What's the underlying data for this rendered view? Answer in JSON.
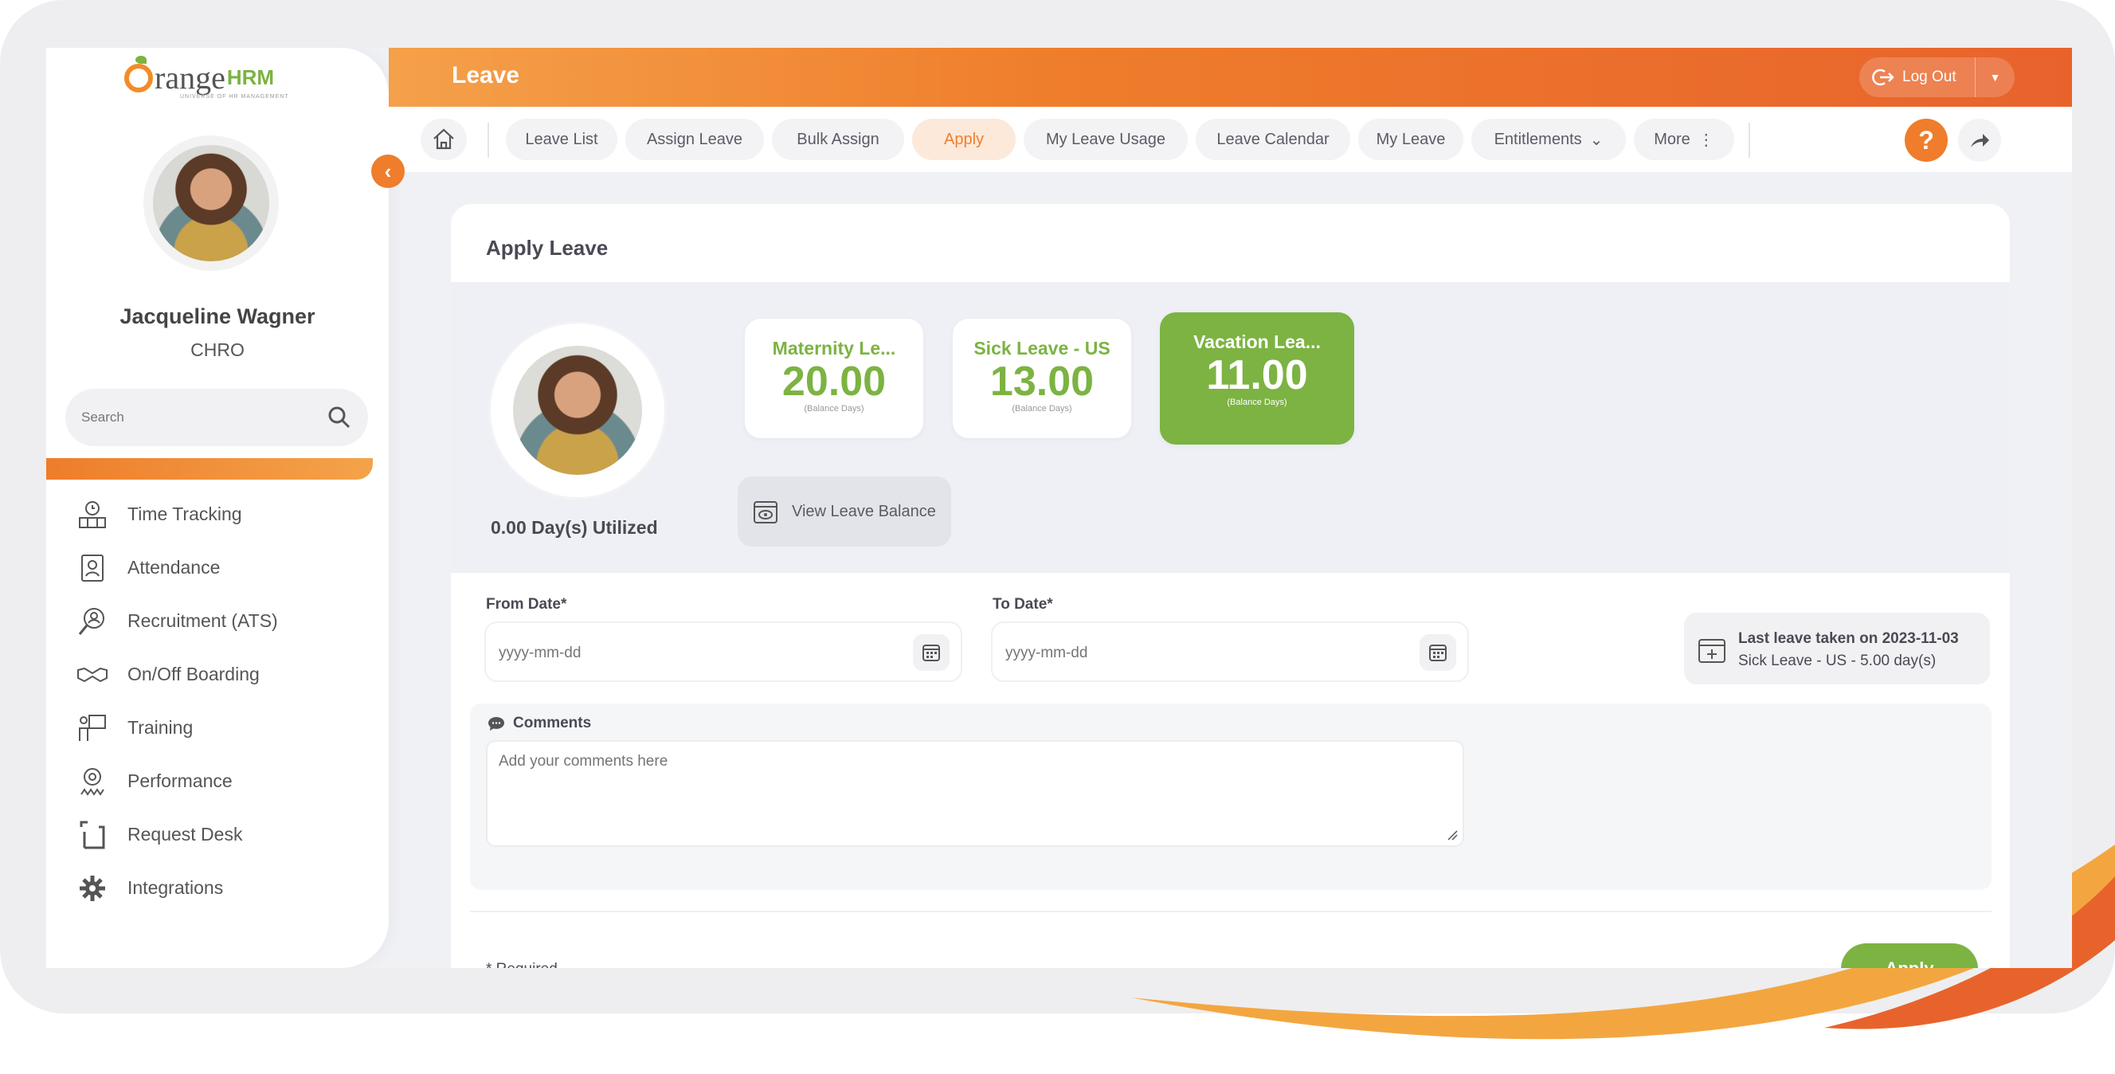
{
  "brand": {
    "logo_text_1": "range",
    "logo_text_2": "HRM",
    "logo_tagline": "UNIVERSE OF HR MANAGEMENT"
  },
  "user": {
    "name": "Jacqueline Wagner",
    "role": "CHRO"
  },
  "sidebar": {
    "search_placeholder": "Search",
    "items": [
      {
        "label": "Time Tracking",
        "icon": "clock-people-icon"
      },
      {
        "label": "Attendance",
        "icon": "badge-icon"
      },
      {
        "label": "Recruitment (ATS)",
        "icon": "magnifier-person-icon"
      },
      {
        "label": "On/Off Boarding",
        "icon": "handshake-icon"
      },
      {
        "label": "Training",
        "icon": "presenter-icon"
      },
      {
        "label": "Performance",
        "icon": "award-icon"
      },
      {
        "label": "Request Desk",
        "icon": "request-desk-icon"
      },
      {
        "label": "Integrations",
        "icon": "puzzle-gear-icon"
      }
    ]
  },
  "header": {
    "title": "Leave",
    "logout_label": "Log Out"
  },
  "tabs": [
    "Leave List",
    "Assign Leave",
    "Bulk Assign",
    "Apply",
    "My Leave Usage",
    "Leave Calendar",
    "My Leave",
    "Entitlements",
    "More"
  ],
  "active_tab": "Apply",
  "help_label": "?",
  "page": {
    "title": "Apply Leave",
    "utilized": "0.00 Day(s) Utilized",
    "balances": [
      {
        "name": "Maternity Le...",
        "value": "20.00",
        "sub": "(Balance Days)",
        "selected": false
      },
      {
        "name": "Sick Leave - US",
        "value": "13.00",
        "sub": "(Balance Days)",
        "selected": false
      },
      {
        "name": "Vacation Lea...",
        "value": "11.00",
        "sub": "(Balance Days)",
        "selected": true
      }
    ],
    "view_balance_label": "View Leave Balance",
    "from_date_label": "From Date*",
    "from_date_placeholder": "yyyy-mm-dd",
    "to_date_label": "To Date*",
    "to_date_placeholder": "yyyy-mm-dd",
    "last_leave_line1": "Last leave taken on 2023-11-03",
    "last_leave_line2": "Sick Leave - US - 5.00 day(s)",
    "comments_label": "Comments",
    "comments_placeholder": "Add your comments here",
    "required_note": "* Required",
    "apply_button": "Apply"
  },
  "colors": {
    "accent": "#ef7d2b",
    "green": "#7cb342",
    "background": "#f0f1f5"
  }
}
